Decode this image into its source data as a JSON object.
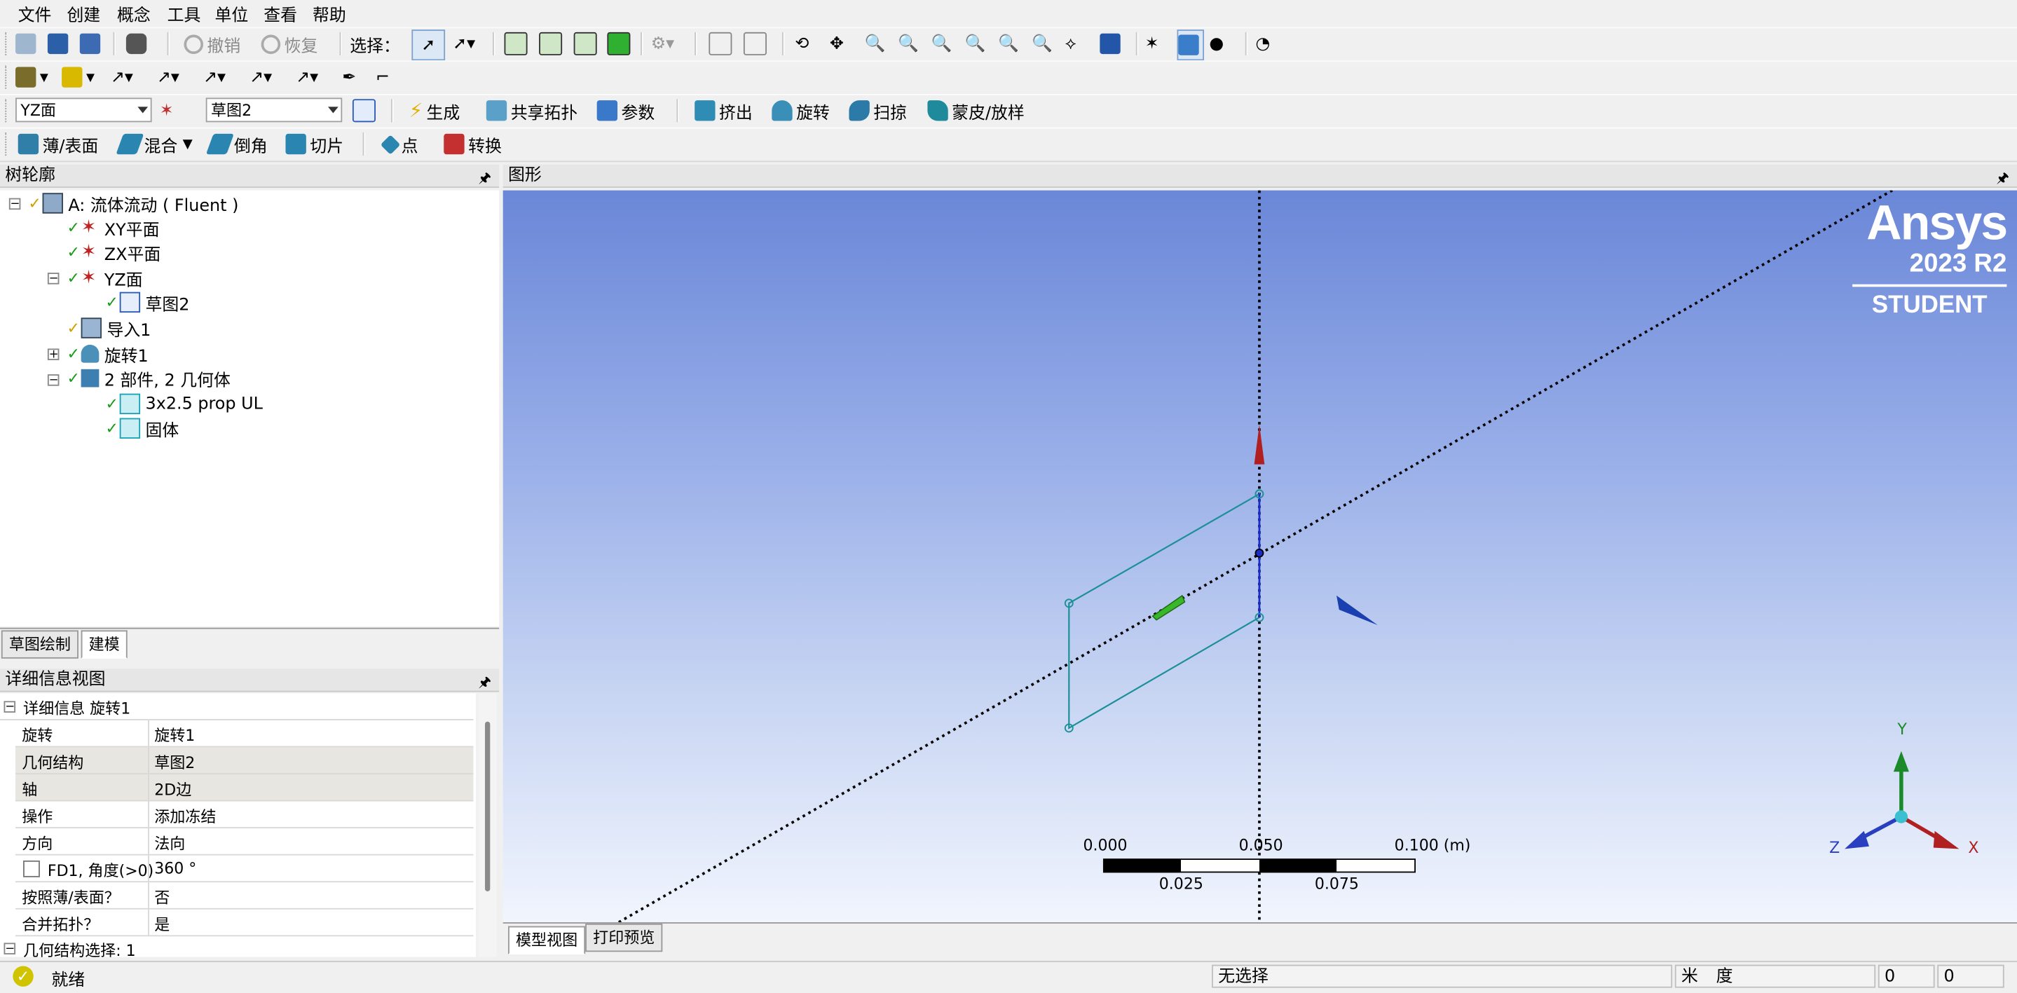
{
  "menu": [
    "文件",
    "创建",
    "概念",
    "工具",
    "单位",
    "查看",
    "帮助"
  ],
  "toolbar1": {
    "undo_label": "撤销",
    "redo_label": "恢复",
    "select_label": "选择："
  },
  "toolbar3": {
    "plane_combo": "YZ面",
    "sketch_combo": "草图2",
    "generate": "生成",
    "share_topology": "共享拓扑",
    "parameters": "参数",
    "extrude": "挤出",
    "revolve": "旋转",
    "sweep": "扫掠",
    "skin_loft": "蒙皮/放样"
  },
  "toolbar4": {
    "thin_surface": "薄/表面",
    "blend": "混合",
    "chamfer": "倒角",
    "slice": "切片",
    "point": "点",
    "conversion": "转换"
  },
  "tree_panel": {
    "title": "树轮廓",
    "nodes": [
      {
        "label": "A: 流体流动 ( Fluent )"
      },
      {
        "label": "XY平面"
      },
      {
        "label": "ZX平面"
      },
      {
        "label": "YZ面"
      },
      {
        "label": "草图2"
      },
      {
        "label": "导入1"
      },
      {
        "label": "旋转1"
      },
      {
        "label": "2 部件, 2 几何体"
      },
      {
        "label": "3x2.5 prop UL"
      },
      {
        "label": "固体"
      }
    ],
    "tabs": [
      "草图绘制",
      "建模"
    ]
  },
  "details_panel": {
    "title": "详细信息视图",
    "section": "详细信息 旋转1",
    "rows": [
      {
        "k": "旋转",
        "v": "旋转1"
      },
      {
        "k": "几何结构",
        "v": "草图2"
      },
      {
        "k": "轴",
        "v": "2D边"
      },
      {
        "k": "操作",
        "v": "添加冻结"
      },
      {
        "k": "方向",
        "v": "法向"
      },
      {
        "k": "FD1, 角度(>0)",
        "v": "360 °"
      },
      {
        "k": "按照薄/表面？",
        "v": "否"
      },
      {
        "k": "合并拓扑？",
        "v": "是"
      }
    ],
    "section2": "几何结构选择: 1"
  },
  "graphics": {
    "title": "图形",
    "brand": "Ansys",
    "version": "2023 R2",
    "edition": "STUDENT",
    "scale_top": [
      "0.000",
      "0.050",
      "0.100 (m)"
    ],
    "scale_bottom": [
      "0.025",
      "0.075"
    ],
    "axis_x": "X",
    "axis_y": "Y",
    "axis_z": "Z",
    "tabs": [
      "模型视图",
      "打印预览"
    ]
  },
  "status": {
    "ready": "就绪",
    "selection": "无选择",
    "units_length": "米",
    "units_angle": "度",
    "val1": "0",
    "val2": "0"
  }
}
